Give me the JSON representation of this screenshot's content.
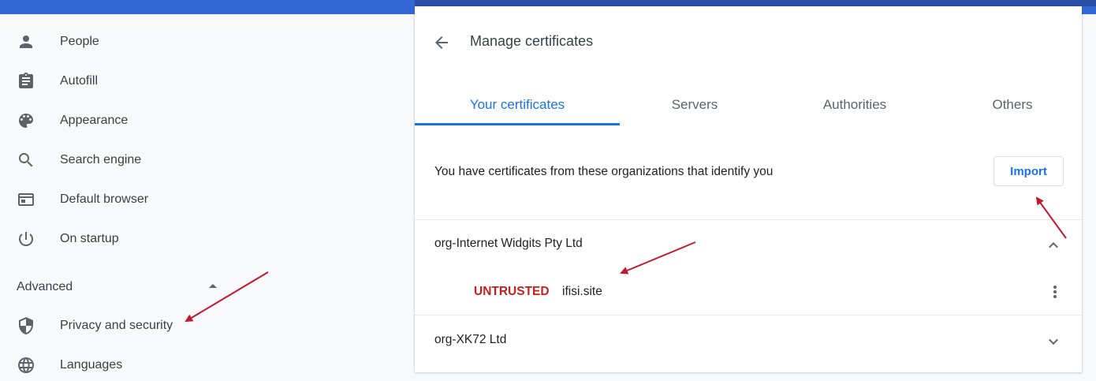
{
  "sidebar": {
    "items": [
      {
        "label": "People",
        "icon": "person-icon"
      },
      {
        "label": "Autofill",
        "icon": "clipboard-icon"
      },
      {
        "label": "Appearance",
        "icon": "palette-icon"
      },
      {
        "label": "Search engine",
        "icon": "search-icon"
      },
      {
        "label": "Default browser",
        "icon": "browser-window-icon"
      },
      {
        "label": "On startup",
        "icon": "power-icon"
      }
    ],
    "advanced_label": "Advanced",
    "advanced_items": [
      {
        "label": "Privacy and security",
        "icon": "shield-icon"
      },
      {
        "label": "Languages",
        "icon": "globe-icon"
      }
    ]
  },
  "certificates": {
    "title": "Manage certificates",
    "tabs": [
      "Your certificates",
      "Servers",
      "Authorities",
      "Others"
    ],
    "active_tab": "Your certificates",
    "description": "You have certificates from these organizations that identify you",
    "import_label": "Import",
    "orgs": [
      {
        "name": "org-Internet Widgits Pty Ltd",
        "expanded": true,
        "certs": [
          {
            "status": "UNTRUSTED",
            "name": "ifisi.site"
          }
        ]
      },
      {
        "name": "org-XK72 Ltd",
        "expanded": false
      }
    ]
  },
  "colors": {
    "accent": "#1a73e8",
    "untrusted": "#c5221f",
    "annotation_arrow": "#c0182d",
    "header_bar": "#3367d6"
  }
}
